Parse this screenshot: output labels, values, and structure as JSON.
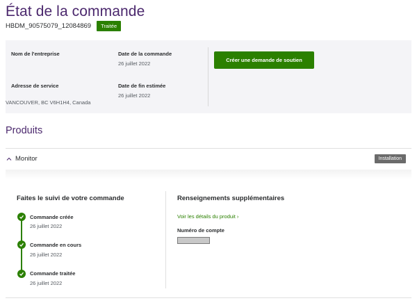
{
  "header": {
    "title": "État de la commande",
    "order_id": "HBDM_90575079_12084869",
    "status": "Traitée"
  },
  "order_info": {
    "company_label": "Nom de l'entreprise",
    "company_value": "",
    "order_date_label": "Date de la commande",
    "order_date_value": "26 juillet 2022",
    "service_address_label": "Adresse de service",
    "service_address_value": "VANCOUVER, BC V6H1H4, Canada",
    "est_end_date_label": "Date de fin estimée",
    "est_end_date_value": "26 juillet 2022",
    "support_button_label": "Créer une demande de soutien"
  },
  "products": {
    "heading": "Produits",
    "items": [
      {
        "name": "Monitor",
        "badge": "Installation",
        "expanded": true,
        "tracking": {
          "title": "Faites le suivi de votre commande",
          "steps": [
            {
              "title": "Commande créée",
              "date": "26 juillet 2022",
              "done": true
            },
            {
              "title": "Commande en cours",
              "date": "26 juillet 2022",
              "done": true
            },
            {
              "title": "Commande traitée",
              "date": "26 juillet 2022",
              "done": true
            }
          ]
        },
        "extra": {
          "title": "Renseignements supplémentaires",
          "details_link": "Voir les détails du produit",
          "account_label": "Numéro de compte",
          "account_value_redacted": true
        }
      }
    ]
  },
  "colors": {
    "brand_purple": "#4b286d",
    "success_green": "#2b8000",
    "panel_bg": "#f4f4f7",
    "neutral_badge": "#6b6b6b"
  }
}
